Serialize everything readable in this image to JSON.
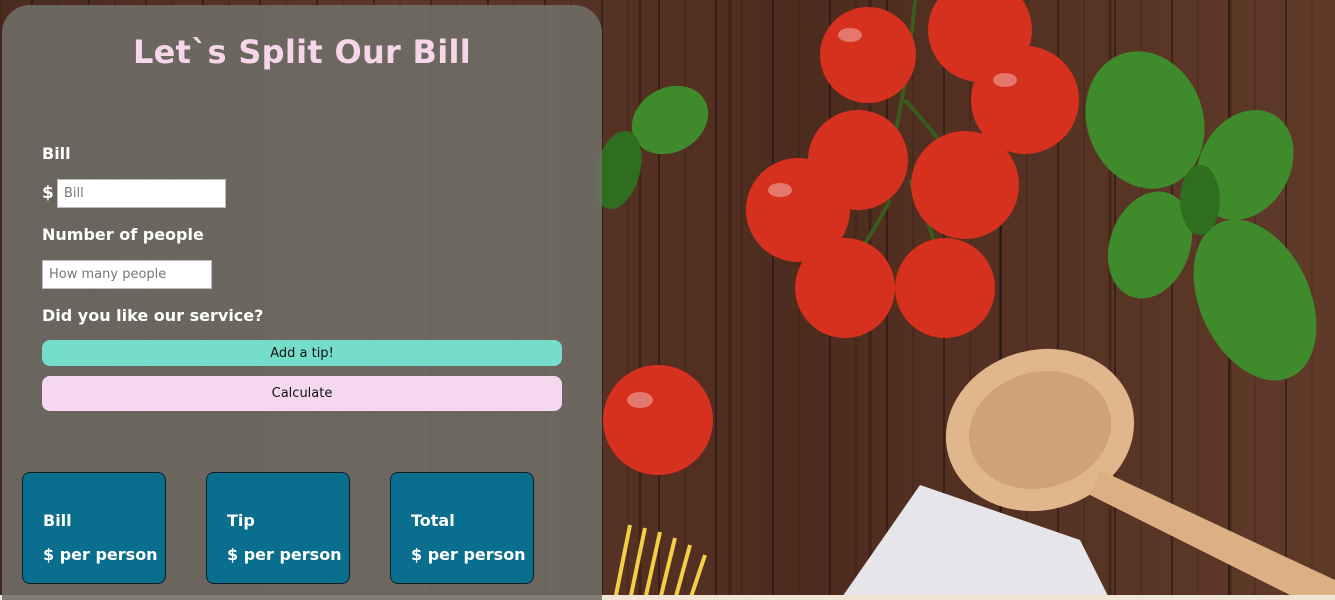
{
  "header": {
    "title": "Let`s Split Our Bill"
  },
  "form": {
    "bill_label": "Bill",
    "currency_symbol": "$",
    "bill_placeholder": "Bill",
    "people_label": "Number of people",
    "people_placeholder": "How many people",
    "service_question": "Did you like our service?",
    "tip_button_label": "Add a tip!",
    "calculate_button_label": "Calculate"
  },
  "results": [
    {
      "title": "Bill",
      "value": "$ per person"
    },
    {
      "title": "Tip",
      "value": "$ per person"
    },
    {
      "title": "Total",
      "value": "$ per person"
    }
  ],
  "colors": {
    "title": "#f7d6ea",
    "tip_button": "#75decb",
    "calculate_button": "#f5d7ef",
    "result_card": "#0a6f8f"
  },
  "background_image": "wooden table with cherry tomatoes, basil, spaghetti and wooden spoon"
}
